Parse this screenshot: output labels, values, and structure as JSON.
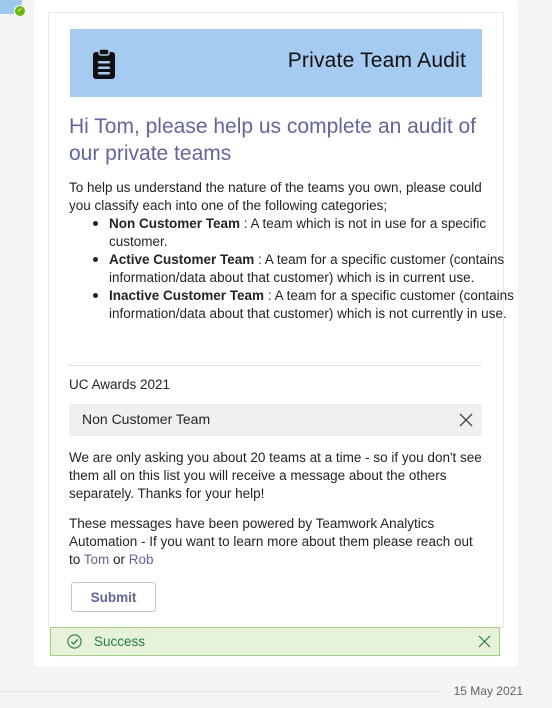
{
  "card": {
    "banner_title": "Private Team Audit",
    "heading": "Hi Tom, please help us complete an audit of our private teams",
    "intro": "To help us understand the nature of the teams you own, please could you classify each into one of the following categories;",
    "categories": [
      {
        "name": "Non Customer Team",
        "desc": " : A team which is not in use for a specific customer."
      },
      {
        "name": "Active Customer Team",
        "desc": " : A team for a specific customer (contains information/data about that customer) which is in current use."
      },
      {
        "name": "Inactive Customer Team",
        "desc": " : A team for a specific customer (contains information/data about that customer) which is not currently in use."
      }
    ],
    "team_name": "UC Awards 2021",
    "selected_category": "Non Customer Team",
    "para1": "We are only asking you about 20 teams at a time - so if you don't see them all on this list you will receive a message about the others separately. Thanks for your help!",
    "para2_prefix": "These messages have been powered by Teamwork Analytics Automation - If you want to learn more about them please reach out to ",
    "link_tom": "Tom",
    "para2_or": " or ",
    "link_rob": "Rob",
    "submit_label": "Submit"
  },
  "status": {
    "success_text": "Success"
  },
  "timestamp": "15 May 2021",
  "colors": {
    "accent": "#6264a7",
    "banner": "#a5cbf0",
    "success_bg": "#e7f2da",
    "success_text": "#237b4b"
  },
  "icons": {
    "banner": "clipboard-icon",
    "clear": "close-icon",
    "success": "check-circle-icon",
    "dismiss": "close-icon"
  }
}
